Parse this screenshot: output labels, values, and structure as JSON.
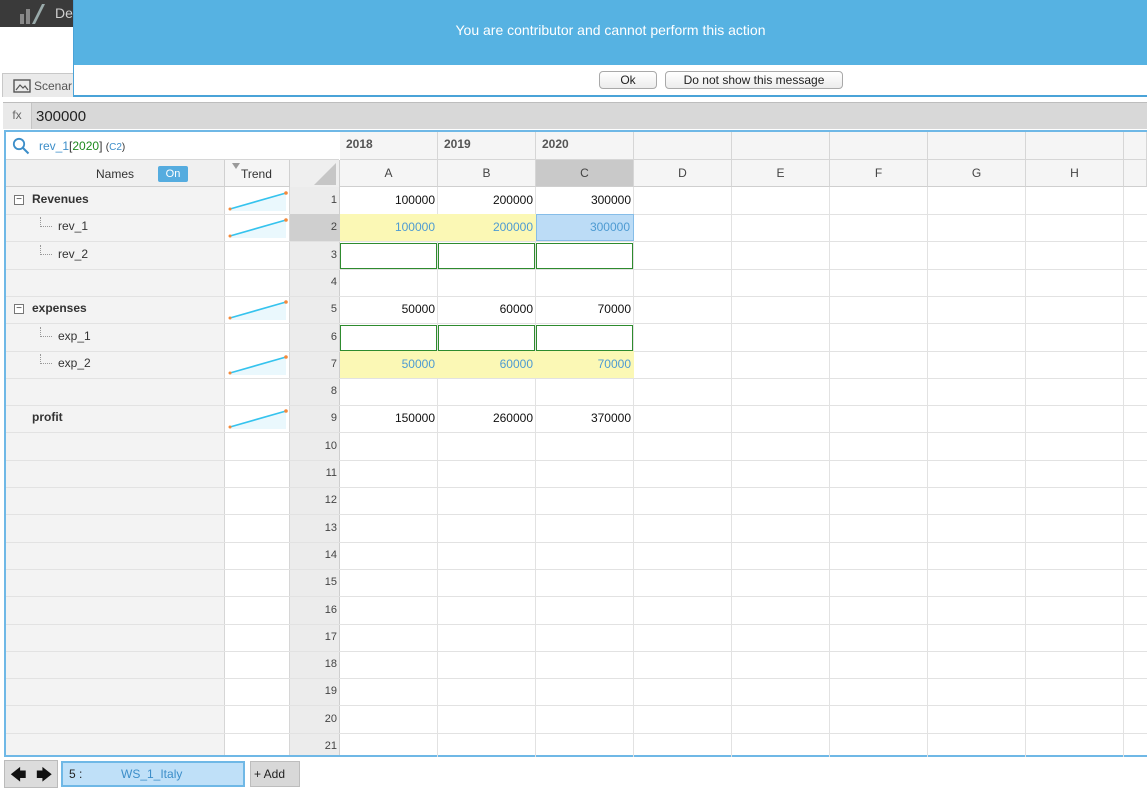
{
  "app": {
    "title": "De"
  },
  "banner": {
    "message": "You are contributor and cannot perform this action",
    "ok_label": "Ok",
    "dont_show_label": "Do not show this message"
  },
  "scenario_tab": {
    "label": "Scenar"
  },
  "formula_bar": {
    "fx_label": "fx",
    "value": "300000"
  },
  "cell_ref": {
    "name": "rev_1",
    "open": "[",
    "period": "2020",
    "close": "]",
    "coord_open": "(",
    "coord": "C2",
    "coord_close": ")"
  },
  "panel": {
    "names_label": "Names",
    "names_toggle": "On",
    "trend_label": "Trend"
  },
  "years": [
    "2018",
    "2019",
    "2020"
  ],
  "columns": [
    "A",
    "B",
    "C",
    "D",
    "E",
    "F",
    "G",
    "H"
  ],
  "rows": [
    {
      "num": "1",
      "name": "Revenues",
      "values": [
        "100000",
        "200000",
        "300000"
      ]
    },
    {
      "num": "2",
      "name": "rev_1",
      "values": [
        "100000",
        "200000",
        "300000"
      ]
    },
    {
      "num": "3",
      "name": "rev_2",
      "values": [
        "",
        "",
        ""
      ]
    },
    {
      "num": "4",
      "name": "",
      "values": [
        "",
        "",
        ""
      ]
    },
    {
      "num": "5",
      "name": "expenses",
      "values": [
        "50000",
        "60000",
        "70000"
      ]
    },
    {
      "num": "6",
      "name": "exp_1",
      "values": [
        "",
        "",
        ""
      ]
    },
    {
      "num": "7",
      "name": "exp_2",
      "values": [
        "50000",
        "60000",
        "70000"
      ]
    },
    {
      "num": "8",
      "name": "",
      "values": [
        "",
        "",
        ""
      ]
    },
    {
      "num": "9",
      "name": "profit",
      "values": [
        "150000",
        "260000",
        "370000"
      ]
    },
    {
      "num": "10"
    },
    {
      "num": "11"
    },
    {
      "num": "12"
    },
    {
      "num": "13"
    },
    {
      "num": "14"
    },
    {
      "num": "15"
    },
    {
      "num": "16"
    },
    {
      "num": "17"
    },
    {
      "num": "18"
    },
    {
      "num": "19"
    },
    {
      "num": "20"
    },
    {
      "num": "21"
    }
  ],
  "bottom": {
    "sheet_index": "5 :",
    "sheet_name": "WS_1_Italy",
    "add_label": "+ Add"
  },
  "colors": {
    "accent": "#56b2e2",
    "input_yellow": "#fbf8b5",
    "selected_blue": "#bcdcf6",
    "input_border_green": "#2e8b2e",
    "sparkline": "#35c3ee",
    "sparkline_end": "#f5893a"
  }
}
